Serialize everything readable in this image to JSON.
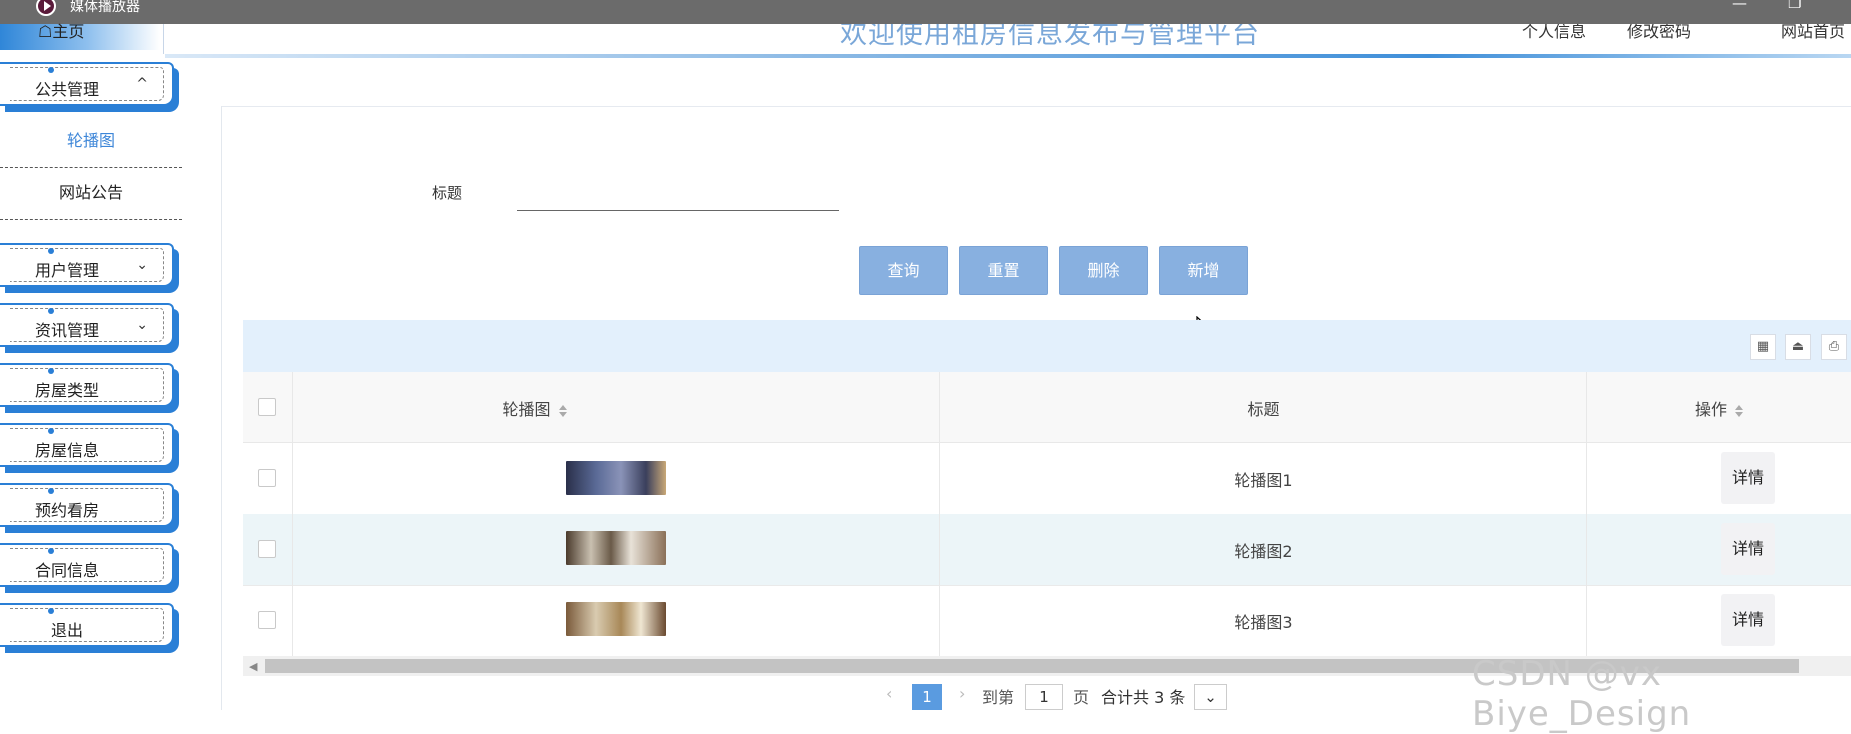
{
  "window": {
    "title": "媒体播放器",
    "minimize": "—",
    "restore": "❐"
  },
  "header": {
    "home": "☖主页",
    "title": "欢迎使用租房信息发布与管理平台",
    "links": [
      "个人信息",
      "修改密码",
      "网站首页"
    ]
  },
  "sidebar": {
    "groups": [
      {
        "label": "公共管理",
        "chevron": "^"
      },
      {
        "label": "用户管理",
        "chevron": "⌄"
      },
      {
        "label": "资讯管理",
        "chevron": "⌄"
      },
      {
        "label": "房屋类型"
      },
      {
        "label": "房屋信息"
      },
      {
        "label": "预约看房"
      },
      {
        "label": "合同信息"
      },
      {
        "label": "退出"
      }
    ],
    "subitems": [
      {
        "label": "轮播图",
        "active": true
      },
      {
        "label": "网站公告",
        "active": false
      }
    ]
  },
  "search": {
    "label": "标题",
    "value": "",
    "placeholder": ""
  },
  "actions": {
    "query": "查询",
    "reset": "重置",
    "delete": "删除",
    "add": "新增"
  },
  "table": {
    "columns": [
      "轮播图",
      "标题",
      "操作"
    ],
    "rows": [
      {
        "title": "轮播图1",
        "action": "详情"
      },
      {
        "title": "轮播图2",
        "action": "详情"
      },
      {
        "title": "轮播图3",
        "action": "详情"
      }
    ]
  },
  "pagination": {
    "current": "1",
    "goto_label": "到第",
    "goto_value": "1",
    "page_unit": "页",
    "total": "合计共 3 条"
  },
  "watermark": "CSDN @vx Biye_Design",
  "colors": {
    "accent": "#2a7fd6",
    "button": "#88b0e0",
    "title": "#7aa7d8",
    "toolbar": "#e3f0fc",
    "pager": "#5a9be0"
  }
}
